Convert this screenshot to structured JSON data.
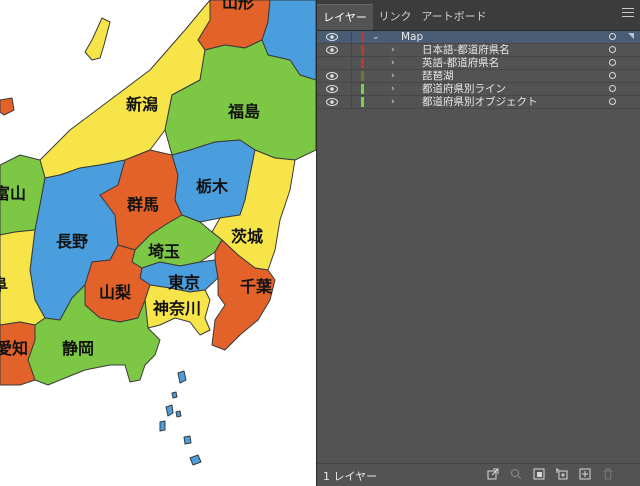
{
  "map": {
    "labels": [
      {
        "text": "新潟",
        "name": "label-niigata"
      },
      {
        "text": "福島",
        "name": "label-fukushima"
      },
      {
        "text": "富山",
        "name": "label-toyama"
      },
      {
        "text": "長野",
        "name": "label-nagano"
      },
      {
        "text": "群馬",
        "name": "label-gunma"
      },
      {
        "text": "栃木",
        "name": "label-tochigi"
      },
      {
        "text": "茨城",
        "name": "label-ibaraki"
      },
      {
        "text": "埼玉",
        "name": "label-saitama"
      },
      {
        "text": "東京",
        "name": "label-tokyo"
      },
      {
        "text": "山梨",
        "name": "label-yamanashi"
      },
      {
        "text": "千葉",
        "name": "label-chiba"
      },
      {
        "text": "神奈川",
        "name": "label-kanagawa"
      },
      {
        "text": "静岡",
        "name": "label-shizuoka"
      },
      {
        "text": "愛知",
        "name": "label-aichi"
      },
      {
        "text": "阜",
        "name": "label-gifu-partial"
      },
      {
        "text": "山形",
        "name": "label-yamagata-partial"
      }
    ],
    "colors": {
      "yellow": "#f7e449",
      "green": "#7cc845",
      "blue": "#4a9ede",
      "orange": "#e2622a",
      "water": "#ffffff",
      "border": "#3a3a3a"
    }
  },
  "panel": {
    "tabs": [
      "レイヤー",
      "リンク",
      "アートボード"
    ],
    "active_tab": "レイヤー",
    "layers": [
      {
        "name": "Map",
        "expanded": true,
        "selected": true,
        "color": "#c0382b"
      },
      {
        "name": "日本語-都道府県名",
        "expanded": false,
        "selected": false,
        "color": "#c0382b"
      },
      {
        "name": "英語-都道府県名",
        "expanded": false,
        "selected": false,
        "color": "#c0382b"
      },
      {
        "name": "琵琶湖",
        "expanded": false,
        "selected": false,
        "color": "#6a7a2a"
      },
      {
        "name": "都道府県別ライン",
        "expanded": false,
        "selected": false,
        "color": "#7ad24a"
      },
      {
        "name": "都道府県別オブジェクト",
        "expanded": false,
        "selected": false,
        "color": "#7ad24a"
      }
    ],
    "footer": {
      "layer_count": "1 レイヤー",
      "icons": [
        "export-icon",
        "search-icon",
        "clipping-mask-icon",
        "new-sublayer-icon",
        "new-layer-icon",
        "trash-icon"
      ]
    },
    "colors": {
      "panel_bg": "#535353",
      "tab_bar": "#3c3c3c",
      "selected_row": "#4a5c74"
    }
  }
}
